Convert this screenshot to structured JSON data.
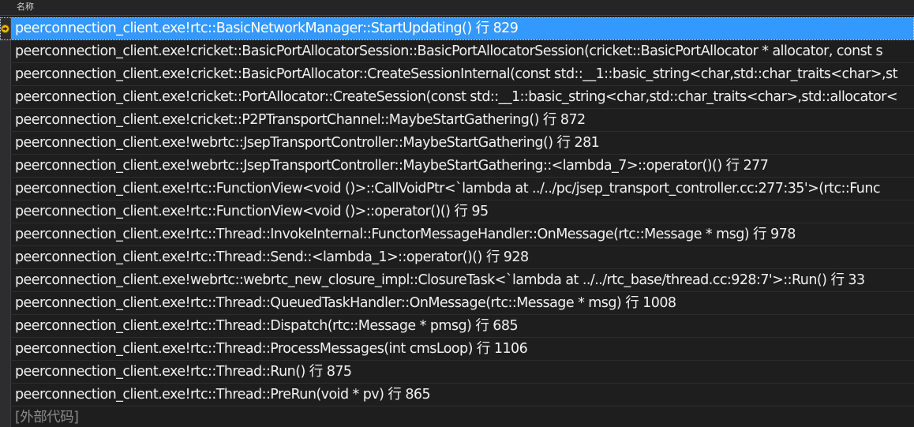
{
  "header": {
    "column_name": "名称"
  },
  "call_stack": {
    "frames": [
      {
        "text": "peerconnection_client.exe!rtc::BasicNetworkManager::StartUpdating() 行 829",
        "current": true
      },
      {
        "text": "peerconnection_client.exe!cricket::BasicPortAllocatorSession::BasicPortAllocatorSession(cricket::BasicPortAllocator * allocator, const s"
      },
      {
        "text": "peerconnection_client.exe!cricket::BasicPortAllocator::CreateSessionInternal(const std::__1::basic_string<char,std::char_traits<char>,st"
      },
      {
        "text": "peerconnection_client.exe!cricket::PortAllocator::CreateSession(const std::__1::basic_string<char,std::char_traits<char>,std::allocator<"
      },
      {
        "text": "peerconnection_client.exe!cricket::P2PTransportChannel::MaybeStartGathering() 行 872"
      },
      {
        "text": "peerconnection_client.exe!webrtc::JsepTransportController::MaybeStartGathering() 行 281"
      },
      {
        "text": "peerconnection_client.exe!webrtc::JsepTransportController::MaybeStartGathering::<lambda_7>::operator()() 行 277"
      },
      {
        "text": "peerconnection_client.exe!rtc::FunctionView<void ()>::CallVoidPtr<`lambda at ../../pc/jsep_transport_controller.cc:277:35'>(rtc::Func"
      },
      {
        "text": "peerconnection_client.exe!rtc::FunctionView<void ()>::operator()() 行 95"
      },
      {
        "text": "peerconnection_client.exe!rtc::Thread::InvokeInternal::FunctorMessageHandler::OnMessage(rtc::Message * msg) 行 978"
      },
      {
        "text": "peerconnection_client.exe!rtc::Thread::Send::<lambda_1>::operator()() 行 928"
      },
      {
        "text": "peerconnection_client.exe!webrtc::webrtc_new_closure_impl::ClosureTask<`lambda at ../../rtc_base/thread.cc:928:7'>::Run() 行 33"
      },
      {
        "text": "peerconnection_client.exe!rtc::Thread::QueuedTaskHandler::OnMessage(rtc::Message * msg) 行 1008"
      },
      {
        "text": "peerconnection_client.exe!rtc::Thread::Dispatch(rtc::Message * pmsg) 行 685"
      },
      {
        "text": "peerconnection_client.exe!rtc::Thread::ProcessMessages(int cmsLoop) 行 1106"
      },
      {
        "text": "peerconnection_client.exe!rtc::Thread::Run() 行 875"
      },
      {
        "text": "peerconnection_client.exe!rtc::Thread::PreRun(void * pv) 行 865"
      },
      {
        "text": "[外部代码]",
        "external": true
      }
    ]
  },
  "colors": {
    "background": "#1e1e1e",
    "selection": "#3399ff",
    "current_frame_marker": "#f0c000",
    "external_code_text": "#8a8a8a"
  },
  "icons": {
    "current_frame": "current-frame-arrow-icon"
  }
}
